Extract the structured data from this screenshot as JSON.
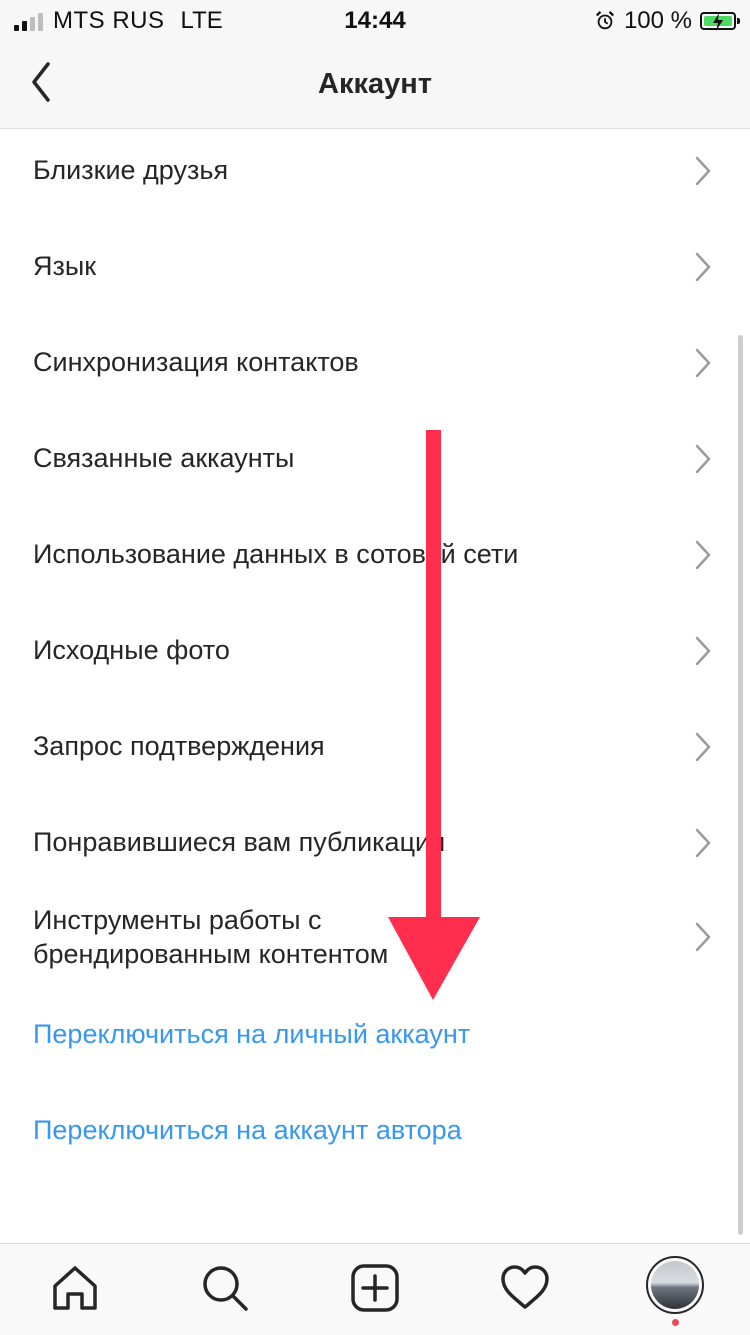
{
  "status_bar": {
    "carrier": "MTS RUS",
    "network": "LTE",
    "time": "14:44",
    "battery_percent": "100 %",
    "icons": [
      "signal-icon",
      "alarm-icon",
      "battery-charging-icon"
    ]
  },
  "header": {
    "title": "Аккаунт",
    "back_icon": "chevron-left-icon"
  },
  "menu": {
    "items": [
      {
        "label": "Близкие друзья"
      },
      {
        "label": "Язык"
      },
      {
        "label": "Синхронизация контактов"
      },
      {
        "label": "Связанные аккаунты"
      },
      {
        "label": "Использование данных в сотовой сети"
      },
      {
        "label": "Исходные фото"
      },
      {
        "label": "Запрос подтверждения"
      },
      {
        "label": "Понравившиеся вам публикации"
      },
      {
        "label_line1": "Инструменты работы с",
        "label_line2": "брендированным контентом"
      }
    ],
    "links": [
      {
        "label": "Переключиться на личный аккаунт"
      },
      {
        "label": "Переключиться на аккаунт автора"
      }
    ]
  },
  "colors": {
    "link": "#3897f0",
    "text": "#262626",
    "annotation_arrow": "#ff2e4f",
    "notification_dot": "#ed4956"
  },
  "tab_bar": {
    "tabs": [
      "home-icon",
      "search-icon",
      "new-post-icon",
      "activity-heart-icon",
      "profile-avatar"
    ]
  }
}
